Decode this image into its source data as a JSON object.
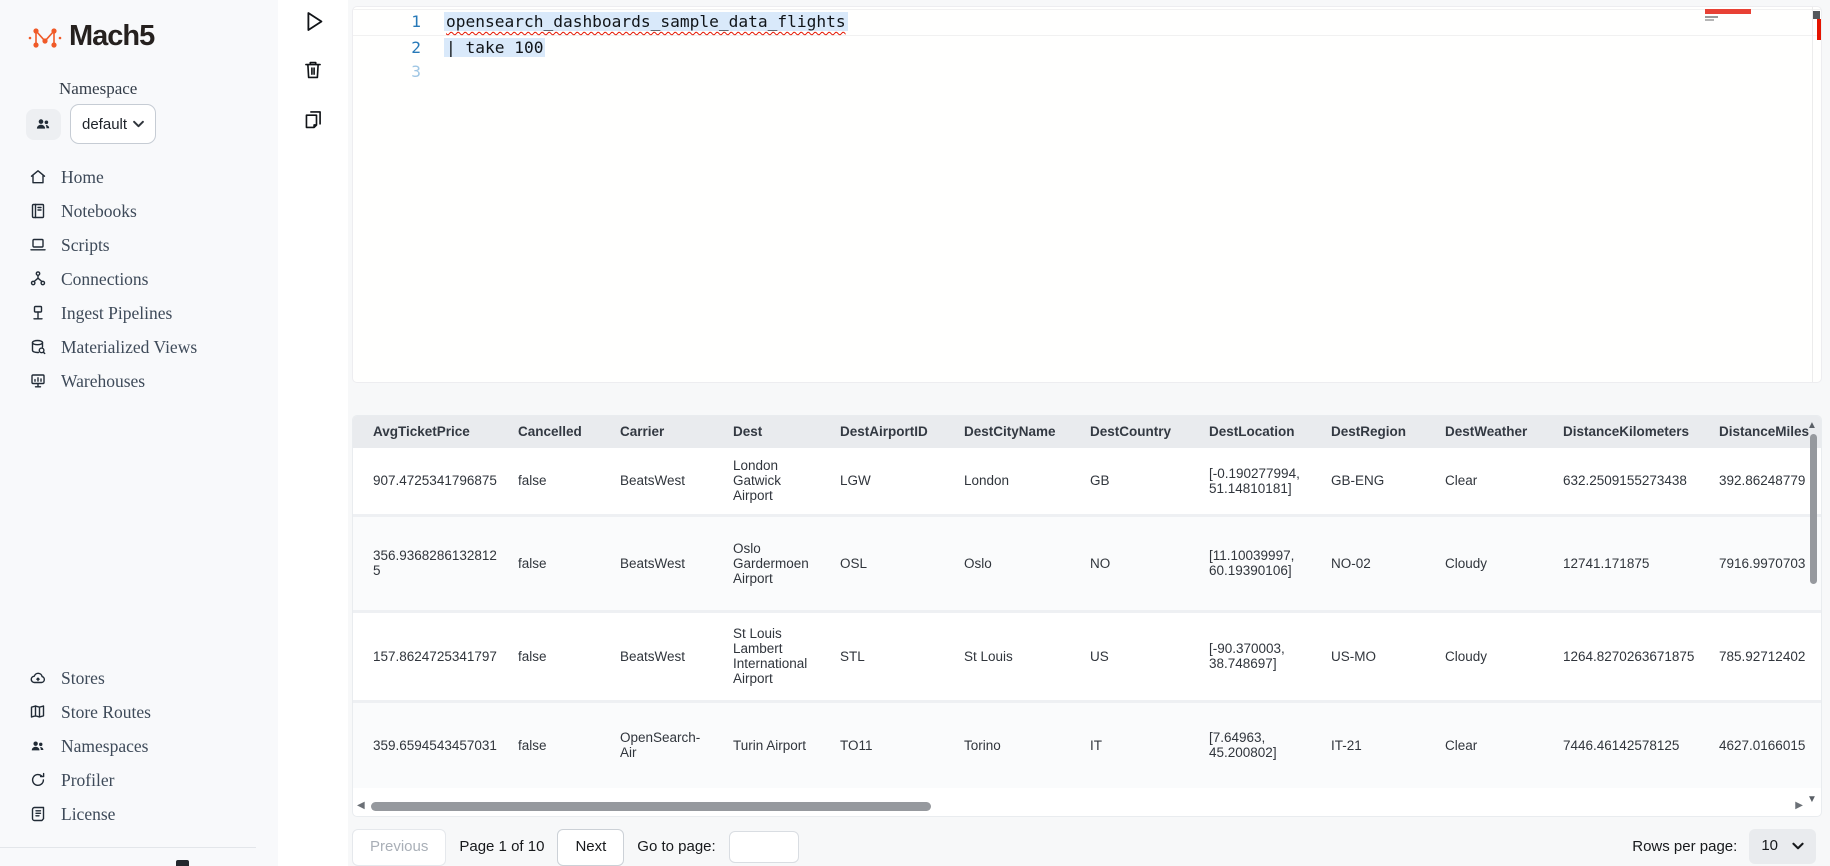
{
  "app": {
    "logo_text": "Mach5"
  },
  "sidebar": {
    "namespace_label": "Namespace",
    "namespace_value": "default",
    "nav_items": [
      {
        "label": "Home",
        "icon": "home-icon"
      },
      {
        "label": "Notebooks",
        "icon": "notebook-icon"
      },
      {
        "label": "Scripts",
        "icon": "scripts-icon"
      },
      {
        "label": "Connections",
        "icon": "connections-icon"
      },
      {
        "label": "Ingest Pipelines",
        "icon": "pipeline-icon"
      },
      {
        "label": "Materialized Views",
        "icon": "materialized-views-icon"
      },
      {
        "label": "Warehouses",
        "icon": "warehouse-icon"
      }
    ],
    "bottom_items": [
      {
        "label": "Stores",
        "icon": "cloud-icon"
      },
      {
        "label": "Store Routes",
        "icon": "map-icon"
      },
      {
        "label": "Namespaces",
        "icon": "people-icon"
      },
      {
        "label": "Profiler",
        "icon": "profiler-icon"
      },
      {
        "label": "License",
        "icon": "license-icon"
      }
    ]
  },
  "toolbar": {
    "run_icon": "play-icon",
    "delete_icon": "trash-icon",
    "copy_icon": "copy-icon"
  },
  "editor": {
    "lines": [
      {
        "number": "1",
        "code": "opensearch_dashboards_sample_data_flights",
        "selected": true,
        "error": true
      },
      {
        "number": "2",
        "code": "| take 100",
        "selected": true,
        "error": false
      },
      {
        "number": "3",
        "code": "",
        "selected": false,
        "error": false
      }
    ],
    "error_color": "#e51400"
  },
  "table": {
    "columns": [
      "AvgTicketPrice",
      "Cancelled",
      "Carrier",
      "Dest",
      "DestAirportID",
      "DestCityName",
      "DestCountry",
      "DestLocation",
      "DestRegion",
      "DestWeather",
      "DistanceKilometers",
      "DistanceMiles"
    ],
    "rows": [
      [
        "907.4725341796875",
        "false",
        "BeatsWest",
        "London Gatwick Airport",
        "LGW",
        "London",
        "GB",
        "[-0.190277994, 51.14810181]",
        "GB-ENG",
        "Clear",
        "632.2509155273438",
        "392.86248779"
      ],
      [
        "356.93682861328125",
        "false",
        "BeatsWest",
        "Oslo Gardermoen Airport",
        "OSL",
        "Oslo",
        "NO",
        "[11.10039997, 60.19390106]",
        "NO-02",
        "Cloudy",
        "12741.171875",
        "7916.9970703"
      ],
      [
        "157.8624725341797",
        "false",
        "BeatsWest",
        "St Louis Lambert International Airport",
        "STL",
        "St Louis",
        "US",
        "[-90.370003, 38.748697]",
        "US-MO",
        "Cloudy",
        "1264.8270263671875",
        "785.92712402"
      ],
      [
        "359.6594543457031",
        "false",
        "OpenSearch-Air",
        "Turin Airport",
        "TO11",
        "Torino",
        "IT",
        "[7.64963, 45.200802]",
        "IT-21",
        "Clear",
        "7446.46142578125",
        "4627.0166015"
      ]
    ]
  },
  "pagination": {
    "previous_label": "Previous",
    "page_status": "Page 1 of 10",
    "next_label": "Next",
    "goto_label": "Go to page:",
    "goto_value": "",
    "rows_per_page_label": "Rows per page:",
    "rows_per_page_value": "10"
  },
  "colors": {
    "brand_orange": "#f05a28",
    "error_red": "#e51400"
  }
}
